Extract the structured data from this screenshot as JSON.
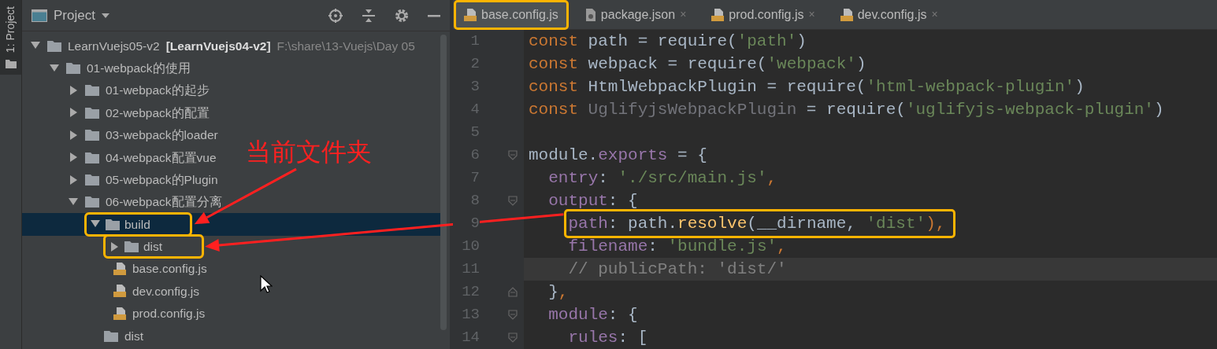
{
  "tool_strip": {
    "label": "1: Project"
  },
  "project_panel": {
    "title": "Project",
    "tree": [
      {
        "kind": "folder",
        "name": "LearnVuejs05-v2",
        "module": "[LearnVuejs04-v2]",
        "path": "F:\\share\\13-Vuejs\\Day 05",
        "expanded": true,
        "selected": false,
        "highlighted": false,
        "children": [
          {
            "kind": "folder",
            "name": "01-webpack的使用",
            "expanded": true,
            "selected": false,
            "highlighted": false,
            "children": [
              {
                "kind": "folder",
                "name": "01-webpack的起步",
                "expanded": false,
                "selected": false,
                "highlighted": false
              },
              {
                "kind": "folder",
                "name": "02-webpack的配置",
                "expanded": false,
                "selected": false,
                "highlighted": false
              },
              {
                "kind": "folder",
                "name": "03-webpack的loader",
                "expanded": false,
                "selected": false,
                "highlighted": false
              },
              {
                "kind": "folder",
                "name": "04-webpack配置vue",
                "expanded": false,
                "selected": false,
                "highlighted": false
              },
              {
                "kind": "folder",
                "name": "05-webpack的Plugin",
                "expanded": false,
                "selected": false,
                "highlighted": false
              },
              {
                "kind": "folder",
                "name": "06-webpack配置分离",
                "expanded": true,
                "selected": false,
                "highlighted": false,
                "children": [
                  {
                    "kind": "folder",
                    "name": "build",
                    "expanded": true,
                    "selected": true,
                    "highlighted": true,
                    "children": [
                      {
                        "kind": "folder",
                        "name": "dist",
                        "expanded": false,
                        "selected": false,
                        "highlighted": true
                      },
                      {
                        "kind": "file",
                        "name": "base.config.js",
                        "selected": false,
                        "highlighted": false
                      },
                      {
                        "kind": "file",
                        "name": "dev.config.js",
                        "selected": false,
                        "highlighted": false
                      },
                      {
                        "kind": "file",
                        "name": "prod.config.js",
                        "selected": false,
                        "highlighted": false
                      }
                    ]
                  },
                  {
                    "kind": "leaf-folder",
                    "name": "dist",
                    "selected": false,
                    "highlighted": false
                  }
                ]
              }
            ]
          }
        ]
      }
    ]
  },
  "editor": {
    "tabs": [
      {
        "label": "base.config.js",
        "kind": "js",
        "selected": true,
        "highlighted": true
      },
      {
        "label": "package.json",
        "kind": "json",
        "selected": false,
        "highlighted": false,
        "close": "×"
      },
      {
        "label": "prod.config.js",
        "kind": "js",
        "selected": false,
        "highlighted": false,
        "close": "×"
      },
      {
        "label": "dev.config.js",
        "kind": "js",
        "selected": false,
        "highlighted": false,
        "close": "×"
      }
    ],
    "lines": [
      {
        "number": "1",
        "kind": "code",
        "current": false,
        "highlighted": false,
        "tokens": [
          {
            "t": "const",
            "color": "#cc7832"
          },
          {
            "t": " path = require(",
            "color": "#a9b7c6"
          },
          {
            "t": "'path'",
            "color": "#6a8759"
          },
          {
            "t": ")",
            "color": "#a9b7c6"
          }
        ]
      },
      {
        "number": "2",
        "kind": "code",
        "current": false,
        "highlighted": false,
        "tokens": [
          {
            "t": "const",
            "color": "#cc7832"
          },
          {
            "t": " webpack = require(",
            "color": "#a9b7c6"
          },
          {
            "t": "'webpack'",
            "color": "#6a8759"
          },
          {
            "t": ")",
            "color": "#a9b7c6"
          }
        ]
      },
      {
        "number": "3",
        "kind": "code",
        "current": false,
        "highlighted": false,
        "tokens": [
          {
            "t": "const",
            "color": "#cc7832"
          },
          {
            "t": " HtmlWebpackPlugin = require(",
            "color": "#a9b7c6"
          },
          {
            "t": "'html-webpack-plugin'",
            "color": "#6a8759"
          },
          {
            "t": ")",
            "color": "#a9b7c6"
          }
        ]
      },
      {
        "number": "4",
        "kind": "code",
        "current": false,
        "highlighted": false,
        "tokens": [
          {
            "t": "const",
            "color": "#cc7832"
          },
          {
            "t": " UglifyjsWebpackPlugin",
            "color": "#72737a"
          },
          {
            "t": " = require(",
            "color": "#a9b7c6"
          },
          {
            "t": "'uglifyjs-webpack-plugin'",
            "color": "#6a8759"
          },
          {
            "t": ")",
            "color": "#a9b7c6"
          }
        ]
      },
      {
        "number": "5",
        "kind": "blank",
        "current": false,
        "highlighted": false
      },
      {
        "number": "6",
        "kind": "fold-open",
        "current": false,
        "highlighted": false,
        "tokens": [
          {
            "t": "module.",
            "color": "#a9b7c6"
          },
          {
            "t": "exports",
            "color": "#9876aa"
          },
          {
            "t": " = {",
            "color": "#a9b7c6"
          }
        ]
      },
      {
        "number": "7",
        "kind": "code",
        "current": false,
        "highlighted": false,
        "tokens": [
          {
            "t": "  entry",
            "color": "#9876aa"
          },
          {
            "t": ": ",
            "color": "#a9b7c6"
          },
          {
            "t": "'./src/main.js'",
            "color": "#6a8759"
          },
          {
            "t": ",",
            "color": "#cc7832"
          }
        ]
      },
      {
        "number": "8",
        "kind": "fold-open",
        "current": false,
        "highlighted": false,
        "tokens": [
          {
            "t": "  output",
            "color": "#9876aa"
          },
          {
            "t": ": {",
            "color": "#a9b7c6"
          }
        ]
      },
      {
        "number": "9",
        "kind": "code",
        "current": false,
        "highlighted": true,
        "tokens": [
          {
            "t": "    path",
            "color": "#9876aa"
          },
          {
            "t": ": path.",
            "color": "#a9b7c6"
          },
          {
            "t": "resolve",
            "color": "#ffc66d"
          },
          {
            "t": "(__dirname, ",
            "color": "#a9b7c6"
          },
          {
            "t": "'dist'",
            "color": "#6a8759"
          },
          {
            "t": "),",
            "color": "#cc7832"
          }
        ]
      },
      {
        "number": "10",
        "kind": "code",
        "current": false,
        "highlighted": false,
        "tokens": [
          {
            "t": "    filename",
            "color": "#9876aa"
          },
          {
            "t": ": ",
            "color": "#a9b7c6"
          },
          {
            "t": "'bundle.js'",
            "color": "#6a8759"
          },
          {
            "t": ",",
            "color": "#cc7832"
          }
        ]
      },
      {
        "number": "11",
        "kind": "code",
        "current": true,
        "highlighted": false,
        "tokens": [
          {
            "t": "    // publicPath: 'dist/'",
            "color": "#808080"
          }
        ]
      },
      {
        "number": "12",
        "kind": "fold-close",
        "current": false,
        "highlighted": false,
        "tokens": [
          {
            "t": "  }",
            "color": "#a9b7c6"
          },
          {
            "t": ",",
            "color": "#cc7832"
          }
        ]
      },
      {
        "number": "13",
        "kind": "fold-open",
        "current": false,
        "highlighted": false,
        "tokens": [
          {
            "t": "  module",
            "color": "#9876aa"
          },
          {
            "t": ": {",
            "color": "#a9b7c6"
          }
        ]
      },
      {
        "number": "14",
        "kind": "fold-open",
        "current": false,
        "highlighted": false,
        "tokens": [
          {
            "t": "    rules",
            "color": "#9876aa"
          },
          {
            "t": ": [",
            "color": "#a9b7c6"
          }
        ]
      }
    ]
  },
  "annotation": {
    "callout": "当前文件夹"
  }
}
